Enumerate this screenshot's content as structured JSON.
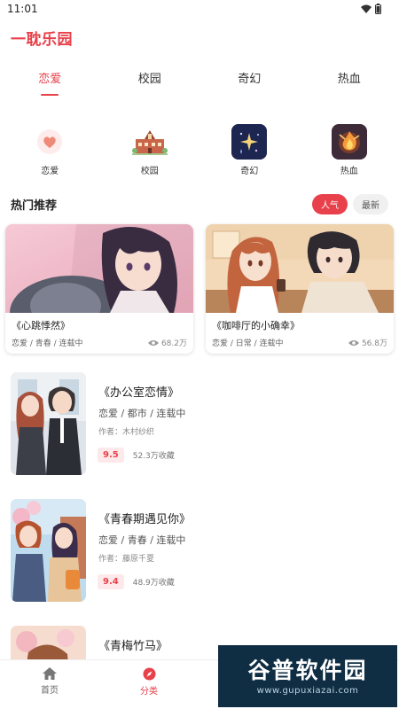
{
  "status": {
    "time": "11:01"
  },
  "app": {
    "title": "一耽乐园"
  },
  "tabs": [
    {
      "label": "恋爱",
      "active": true
    },
    {
      "label": "校园",
      "active": false
    },
    {
      "label": "奇幻",
      "active": false
    },
    {
      "label": "热血",
      "active": false
    }
  ],
  "categories": [
    {
      "label": "恋爱",
      "icon": "heart-icon"
    },
    {
      "label": "校园",
      "icon": "school-building-icon"
    },
    {
      "label": "奇幻",
      "icon": "sparkle-star-icon"
    },
    {
      "label": "热血",
      "icon": "flame-burst-icon"
    }
  ],
  "section": {
    "title": "热门推荐",
    "sort_hot": "人气",
    "sort_new": "最新"
  },
  "hot": [
    {
      "title": "《心跳悸然》",
      "tags": "恋爱 / 青春 / 连载中",
      "views": "68.2万"
    },
    {
      "title": "《咖啡厅的小确幸》",
      "tags": "恋爱 / 日常 / 连载中",
      "views": "56.8万"
    }
  ],
  "books": [
    {
      "title": "《办公室恋情》",
      "genres": "恋爱 / 都市 / 连载中",
      "author": "作者：木村纱织",
      "rating": "9.5",
      "collects": "52.3万收藏"
    },
    {
      "title": "《青春期遇见你》",
      "genres": "恋爱 / 青春 / 连载中",
      "author": "作者：藤原千夏",
      "rating": "9.4",
      "collects": "48.9万收藏"
    },
    {
      "title": "《青梅竹马》"
    }
  ],
  "nav": [
    {
      "label": "首页",
      "icon": "home-icon"
    },
    {
      "label": "分类",
      "icon": "compass-icon"
    }
  ],
  "watermark": {
    "main": "谷普软件园",
    "url": "www.gupuxiazai.com"
  },
  "colors": {
    "accent": "#e8414b",
    "rating_bg": "#fde9e9",
    "watermark_bg": "#0f2e44"
  }
}
